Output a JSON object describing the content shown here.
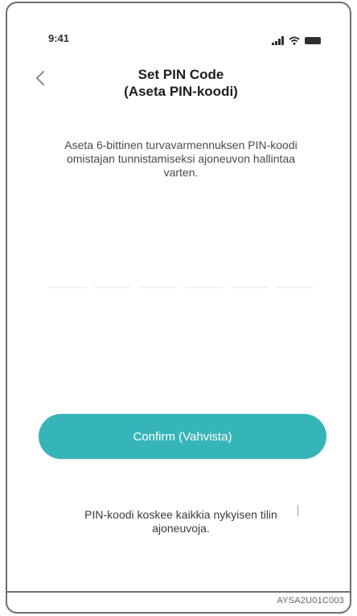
{
  "status_bar": {
    "time": "9:41"
  },
  "header": {
    "title_line1": "Set PIN Code",
    "title_line2": "(Aseta PIN-koodi)"
  },
  "main": {
    "description": "Aseta 6-bittinen turvavarmennuksen PIN-koodi omistajan tunnistamiseksi ajoneuvon hallintaa varten.",
    "pin_length": 6
  },
  "actions": {
    "confirm_label": "Confirm (Vahvista)"
  },
  "footer": {
    "note": "PIN-koodi koskee kaikkia nykyisen tilin ajoneuvoja."
  },
  "image_code": "AYSA2U01C003",
  "colors": {
    "accent": "#36b5b9",
    "frame": "#6e6e6e",
    "text": "#1e1e1e"
  },
  "icons": {
    "back": "chevron-left-icon",
    "signal": "cellular-signal-icon",
    "wifi": "wifi-icon",
    "battery": "battery-icon"
  }
}
